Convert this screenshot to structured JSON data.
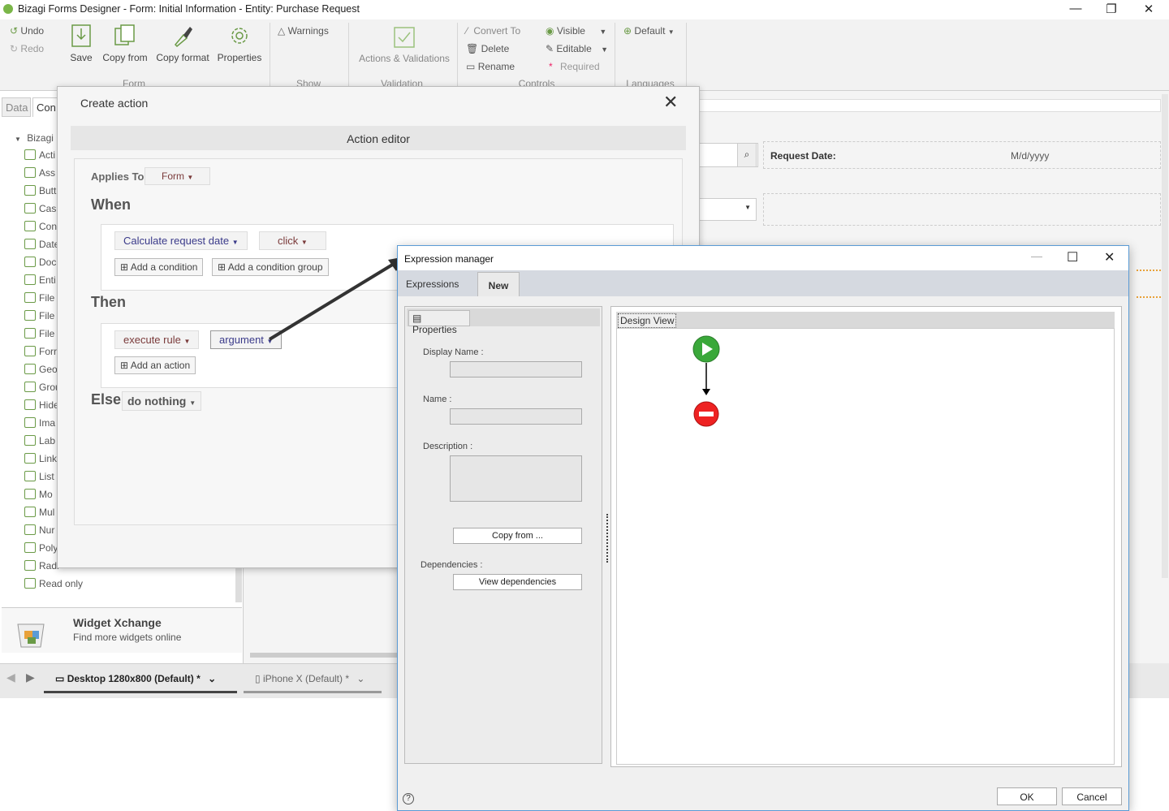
{
  "window": {
    "title": "Bizagi Forms Designer  - Form: Initial Information - Entity:  Purchase Request",
    "minimize": "—",
    "restore": "❐",
    "close": "✕"
  },
  "ribbon": {
    "undo": "Undo",
    "redo": "Redo",
    "save": "Save",
    "copy_from": "Copy from",
    "copy_format": "Copy format",
    "properties": "Properties",
    "warnings": "Warnings",
    "actions_validations": "Actions & Validations",
    "convert_to": "Convert To",
    "delete": "Delete",
    "rename": "Rename",
    "visible": "Visible",
    "editable": "Editable",
    "required": "Required",
    "default": "Default",
    "groups": {
      "form": "Form",
      "show": "Show",
      "validation": "Validation",
      "controls": "Controls",
      "languages": "Languages"
    }
  },
  "left_panel": {
    "tab_data": "Data",
    "tab_controls": "Con",
    "tree_root": "Bizagi",
    "items": [
      "Acti",
      "Ass",
      "Butt",
      "Cas",
      "Con",
      "Date",
      "Doc",
      "Enti",
      "File",
      "File",
      "File",
      "Forr",
      "Geo",
      "Grou",
      "Hide",
      "Ima",
      "Lab",
      "Link",
      "List",
      "Mo",
      "Mul",
      "Nur",
      "Poly",
      "Radi",
      "Read only"
    ],
    "xchange_title": "Widget Xchange",
    "xchange_subtitle": "Find more widgets online"
  },
  "designer": {
    "request_date_label": "Request Date:",
    "request_date_placeholder": "M/d/yyyy"
  },
  "bottom_tabs": {
    "desktop": "Desktop 1280x800 (Default) *",
    "iphone": "iPhone X (Default) *"
  },
  "create_action": {
    "title": "Create action",
    "header": "Action editor",
    "applies_to_label": "Applies To",
    "applies_to_value": "Form",
    "when": "When",
    "condition_control": "Calculate request date",
    "condition_event": "click",
    "add_condition": "Add a condition",
    "add_condition_group": "Add a condition group",
    "then": "Then",
    "action_type": "execute rule",
    "action_argument": "argument",
    "add_action": "Add an action",
    "else": "Else",
    "else_value": "do nothing"
  },
  "expression_manager": {
    "title": "Expression manager",
    "tab_expressions": "Expressions",
    "tab_new": "New",
    "properties_tab": "Properties",
    "display_name_label": "Display Name :",
    "name_label": "Name :",
    "description_label": "Description :",
    "copy_from_button": "Copy from ...",
    "dependencies_label": "Dependencies :",
    "view_dependencies_button": "View dependencies",
    "design_view_tab": "Design View",
    "help": "?",
    "ok": "OK",
    "cancel": "Cancel"
  }
}
